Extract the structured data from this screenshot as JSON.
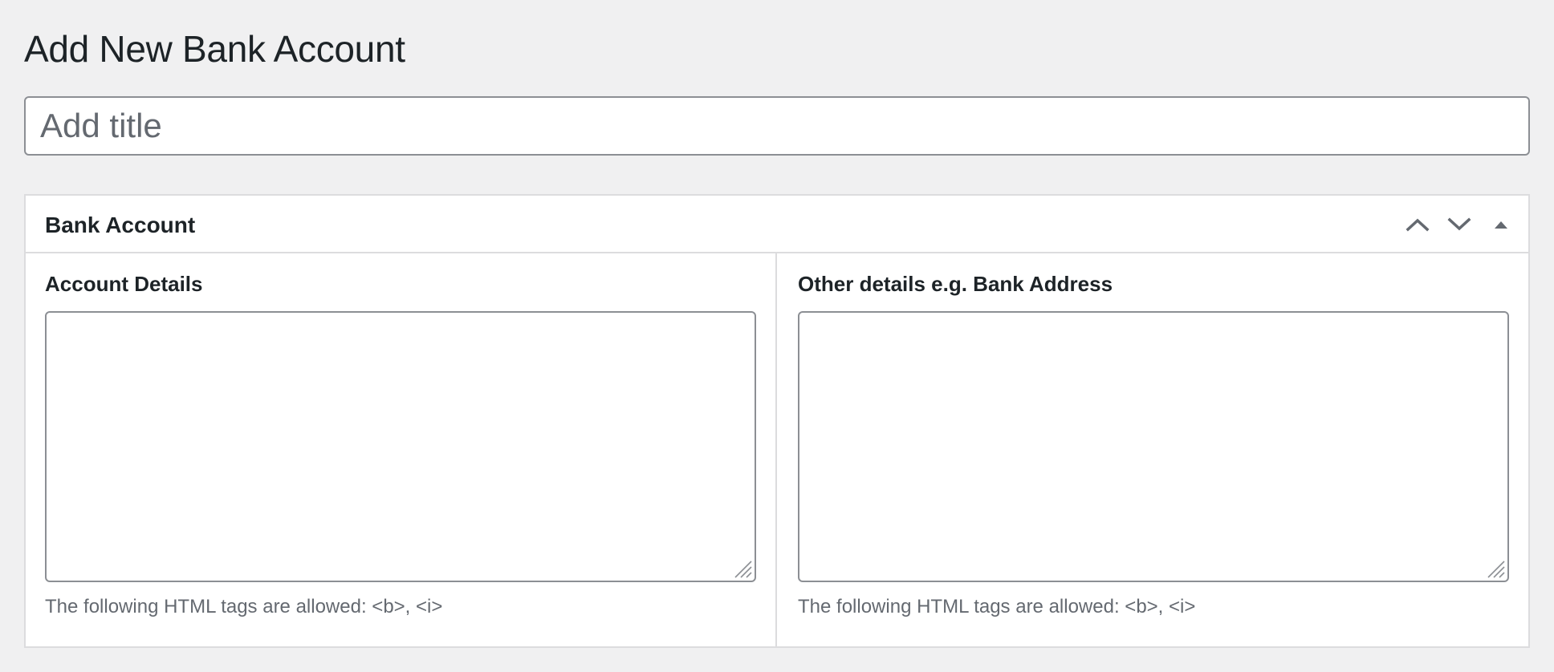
{
  "page": {
    "title": "Add New Bank Account"
  },
  "title_field": {
    "placeholder": "Add title",
    "value": ""
  },
  "metabox": {
    "title": "Bank Account",
    "controls": {
      "move_up_icon": "chevron-up-icon",
      "move_down_icon": "chevron-down-icon",
      "toggle_icon": "triangle-up-icon"
    },
    "fields": [
      {
        "label": "Account Details",
        "value": "",
        "help": "The following HTML tags are allowed: <b>, <i>"
      },
      {
        "label": "Other details e.g. Bank Address",
        "value": "",
        "help": "The following HTML tags are allowed: <b>, <i>"
      }
    ]
  },
  "colors": {
    "background": "#f0f0f1",
    "text": "#1d2327",
    "muted_text": "#646970",
    "input_border": "#8c8f94",
    "box_border": "#dcdcde"
  }
}
